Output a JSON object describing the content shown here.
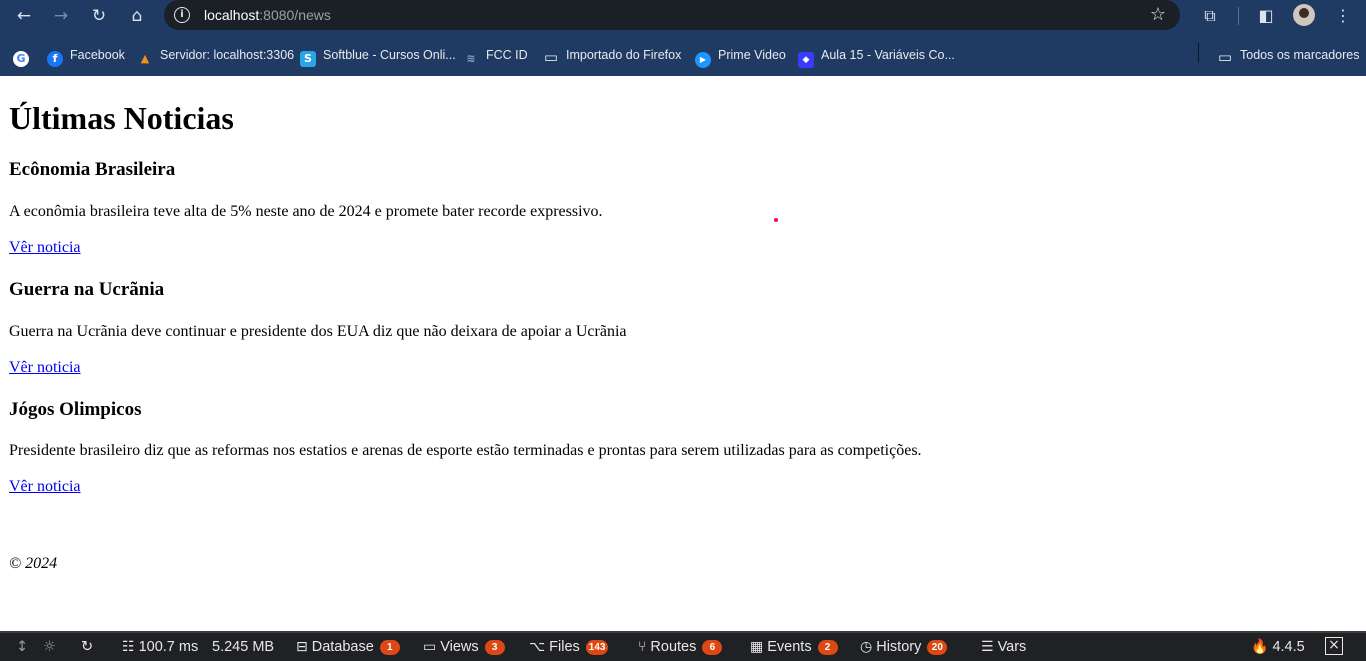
{
  "browser": {
    "url_host": "localhost",
    "url_rest": ":8080/news",
    "nav": {
      "back": "←",
      "forward": "→",
      "reload": "↻",
      "home": "⌂",
      "info": "i",
      "star": "☆",
      "extensions": "⧉",
      "sidepanel": "◧",
      "menu": "⋮"
    }
  },
  "bookmarks": [
    {
      "label": "",
      "icon": "G",
      "color": "#ffffff",
      "icon_color": "#4285f4"
    },
    {
      "label": "Facebook",
      "icon": "f",
      "color": "#1877f2",
      "icon_color": "#ffffff"
    },
    {
      "label": "Servidor: localhost:3306",
      "icon": "▲",
      "color": "#1f3b63",
      "icon_color": "#f29111"
    },
    {
      "label": "Softblue - Cursos Onli...",
      "icon": "S",
      "color": "#2aa4e8",
      "icon_color": "#ffffff"
    },
    {
      "label": "FCC ID",
      "icon": "≋",
      "color": "#1f3b63",
      "icon_color": "#8aa1bd"
    },
    {
      "label": "Importado do Firefox",
      "icon": "▭",
      "color": "#1f3b63",
      "icon_color": "#e8eaed"
    },
    {
      "label": "Prime Video",
      "icon": "▶",
      "color": "#1a98ff",
      "icon_color": "#ffffff"
    },
    {
      "label": "Aula 15 - Variáveis Co...",
      "icon": "◆",
      "color": "#3b3bff",
      "icon_color": "#ffffff"
    },
    {
      "label": "Todos os marcadores",
      "icon": "▭",
      "color": "#1f3b63",
      "icon_color": "#e8eaed"
    }
  ],
  "page": {
    "heading": "Últimas Noticias",
    "articles": [
      {
        "title": "Ecônomia Brasileira",
        "body": "A econômia brasileira teve alta de 5% neste ano de 2024 e promete bater recorde expressivo.",
        "link": "Vêr noticia"
      },
      {
        "title": "Guerra na Ucrãnia",
        "body": "Guerra na Ucrãnia deve continuar e presidente dos EUA diz que não deixara de apoiar a Ucrãnia",
        "link": "Vêr noticia"
      },
      {
        "title": "Jógos Olimpicos",
        "body": "Presidente brasileiro diz que as reformas nos estatios e arenas de esporte estão terminadas e prontas para serem utilizadas para as competições.",
        "link": "Vêr noticia"
      }
    ],
    "footer": "© 2024"
  },
  "debugbar": {
    "time": "100.7 ms",
    "memory": "5.245 MB",
    "items": [
      {
        "label": "Database",
        "count": "1",
        "icon": "⊟"
      },
      {
        "label": "Views",
        "count": "3",
        "icon": "▭"
      },
      {
        "label": "Files",
        "count": "143",
        "icon": "⌥"
      },
      {
        "label": "Routes",
        "count": "6",
        "icon": "⑂"
      },
      {
        "label": "Events",
        "count": "2",
        "icon": "▦"
      },
      {
        "label": "History",
        "count": "20",
        "icon": "◷"
      },
      {
        "label": "Vars",
        "count": "",
        "icon": "☰"
      }
    ],
    "version": "4.4.5"
  }
}
